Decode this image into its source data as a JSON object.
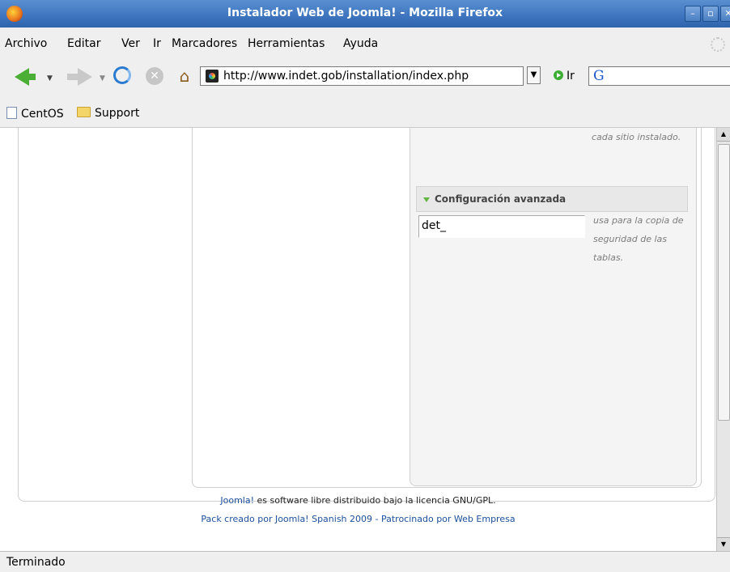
{
  "window": {
    "title": "Instalador Web de Joomla! - Mozilla Firefox",
    "buttons": [
      "–",
      "▫",
      "✕"
    ]
  },
  "menu": {
    "items": [
      "Archivo",
      "Editar",
      "Ver",
      "Ir",
      "Marcadores",
      "Herramientas",
      "Ayuda"
    ]
  },
  "nav": {
    "url": "http://www.indet.gob/installation/index.php",
    "go_label": "Ir",
    "search_engine_glyph": "G"
  },
  "bookmarks": {
    "items": [
      "CentOS",
      "Support"
    ]
  },
  "content": {
    "hint_top": "cada sitio instalado.",
    "advanced_header": "Configuración avanzada",
    "prefix_value": "det_",
    "hint_lines": [
      "usa para la copia de",
      "seguridad de las",
      "tablas."
    ],
    "footer_link": "Joomla!",
    "footer_text": " es software libre distribuido bajo la licencia GNU/GPL.",
    "footer_line2": "Pack creado por Joomla! Spanish 2009 - Patrocinado por Web Empresa"
  },
  "status": {
    "text": "Terminado"
  }
}
